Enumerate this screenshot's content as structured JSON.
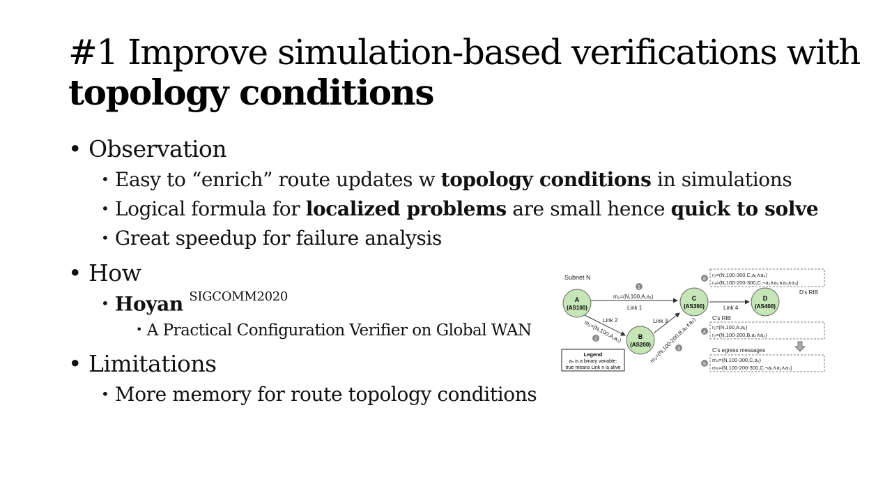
{
  "title": {
    "line1": "#1 Improve simulation-based verifications with",
    "line2": "topology conditions"
  },
  "bullets": {
    "observation": {
      "label": "Observation",
      "item1": {
        "pre": "Easy to “enrich” route updates w ",
        "bold": "topology conditions",
        "post": " in simulations"
      },
      "item2": {
        "pre": "Logical formula for ",
        "bold1": "localized problems",
        "mid": " are small hence ",
        "bold2": "quick to solve"
      },
      "item3": "Great speedup for failure analysis"
    },
    "how": {
      "label": "How",
      "hoyan": "Hoyan",
      "venue": "SIGCOMM2020",
      "sub": "A Practical Configuration Verifier on Global WAN"
    },
    "limitations": {
      "label": "Limitations",
      "item1": "More memory for route topology conditions"
    }
  },
  "diagram": {
    "subnet": "Subnet N",
    "nodes": {
      "a": {
        "name": "A",
        "as": "(AS100)"
      },
      "b": {
        "name": "B",
        "as": "(AS200)"
      },
      "c": {
        "name": "C",
        "as": "(AS300)"
      },
      "d": {
        "name": "D",
        "as": "(AS400)"
      }
    },
    "links": {
      "l1": "Link 1",
      "l2": "Link 2",
      "l3": "Link 3",
      "l4": "Link 4"
    },
    "messages": {
      "m1": "m₁=(N,100,A,a₁)",
      "m2": "m₂=(N,100,A,a₂)",
      "m3": "m₃=(N,100-200,B,a₂∧a₃)"
    },
    "steps": [
      "1",
      "2",
      "3",
      "4",
      "5",
      "6"
    ],
    "d_rib": {
      "label": "D’s RIB",
      "r3": "r₃=(N,100-300,C,a₁∧a₄)",
      "r4": "r₄=(N,100-200-300,C,¬a₁∧a₂∧a₃∧a₄)"
    },
    "c_rib": {
      "label": "C’s RIB",
      "r1": "r₁=(N,100,A,a₁)",
      "r2": "r₂=(N,100-200,B,a₂∧a₃)"
    },
    "c_egress": {
      "label": "C’s egress messages",
      "m4": "m₄=(N,100-300,C,a₁)",
      "m5": "m₅=(N,100-200-300,C,¬a₁∧a₂∧a₃)"
    },
    "legend": {
      "title": "Legend",
      "line1": "aₙ is a binary variable:",
      "line2": "true means Link n is alive"
    }
  }
}
